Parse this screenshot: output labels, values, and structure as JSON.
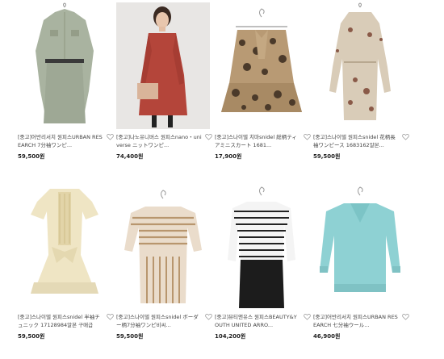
{
  "products": [
    {
      "title": "[중고]어반리서치 원피스URBAN RESEARCH 7分袖ワンピ...",
      "price": "59,500원",
      "image": "dress-sage-belted"
    },
    {
      "title": "[중고]나노유니버스 원피스nano・universe ニットワンピ...",
      "price": "74,400원",
      "image": "knit-dress-red-model"
    },
    {
      "title": "[중고]스나이델 치마snidel 総柄ティアミニスカート 1681...",
      "price": "17,900원",
      "image": "skirt-leopard-tiered"
    },
    {
      "title": "[중고]스나이델 원피스snidel 花柄長袖ワンピース 1683162알본...",
      "price": "59,500원",
      "image": "dress-floral-longsleeve"
    },
    {
      "title": "[중고]스나이델 원피스snidel 半袖チュニック 17128984알본 구매급",
      "price": "59,500원",
      "image": "tunic-cream-lace"
    },
    {
      "title": "[중고]스나이델 원피스snidel ボーダー柄7分袖ワンピ비씨...",
      "price": "59,500원",
      "image": "dress-beige-stripe"
    },
    {
      "title": "[중고]뷰티앤유스 원피스BEAUTY&YOUTH UNITED ARRO...",
      "price": "104,200원",
      "image": "dress-stripe-black-skirt"
    },
    {
      "title": "[중고]어반리서치 원피스URBAN RESEARCH 七分袖ウール...",
      "price": "46,900원",
      "image": "knit-tunic-aqua"
    }
  ],
  "colors": {
    "heart": "#999999",
    "price": "#222222",
    "title": "#444444"
  }
}
